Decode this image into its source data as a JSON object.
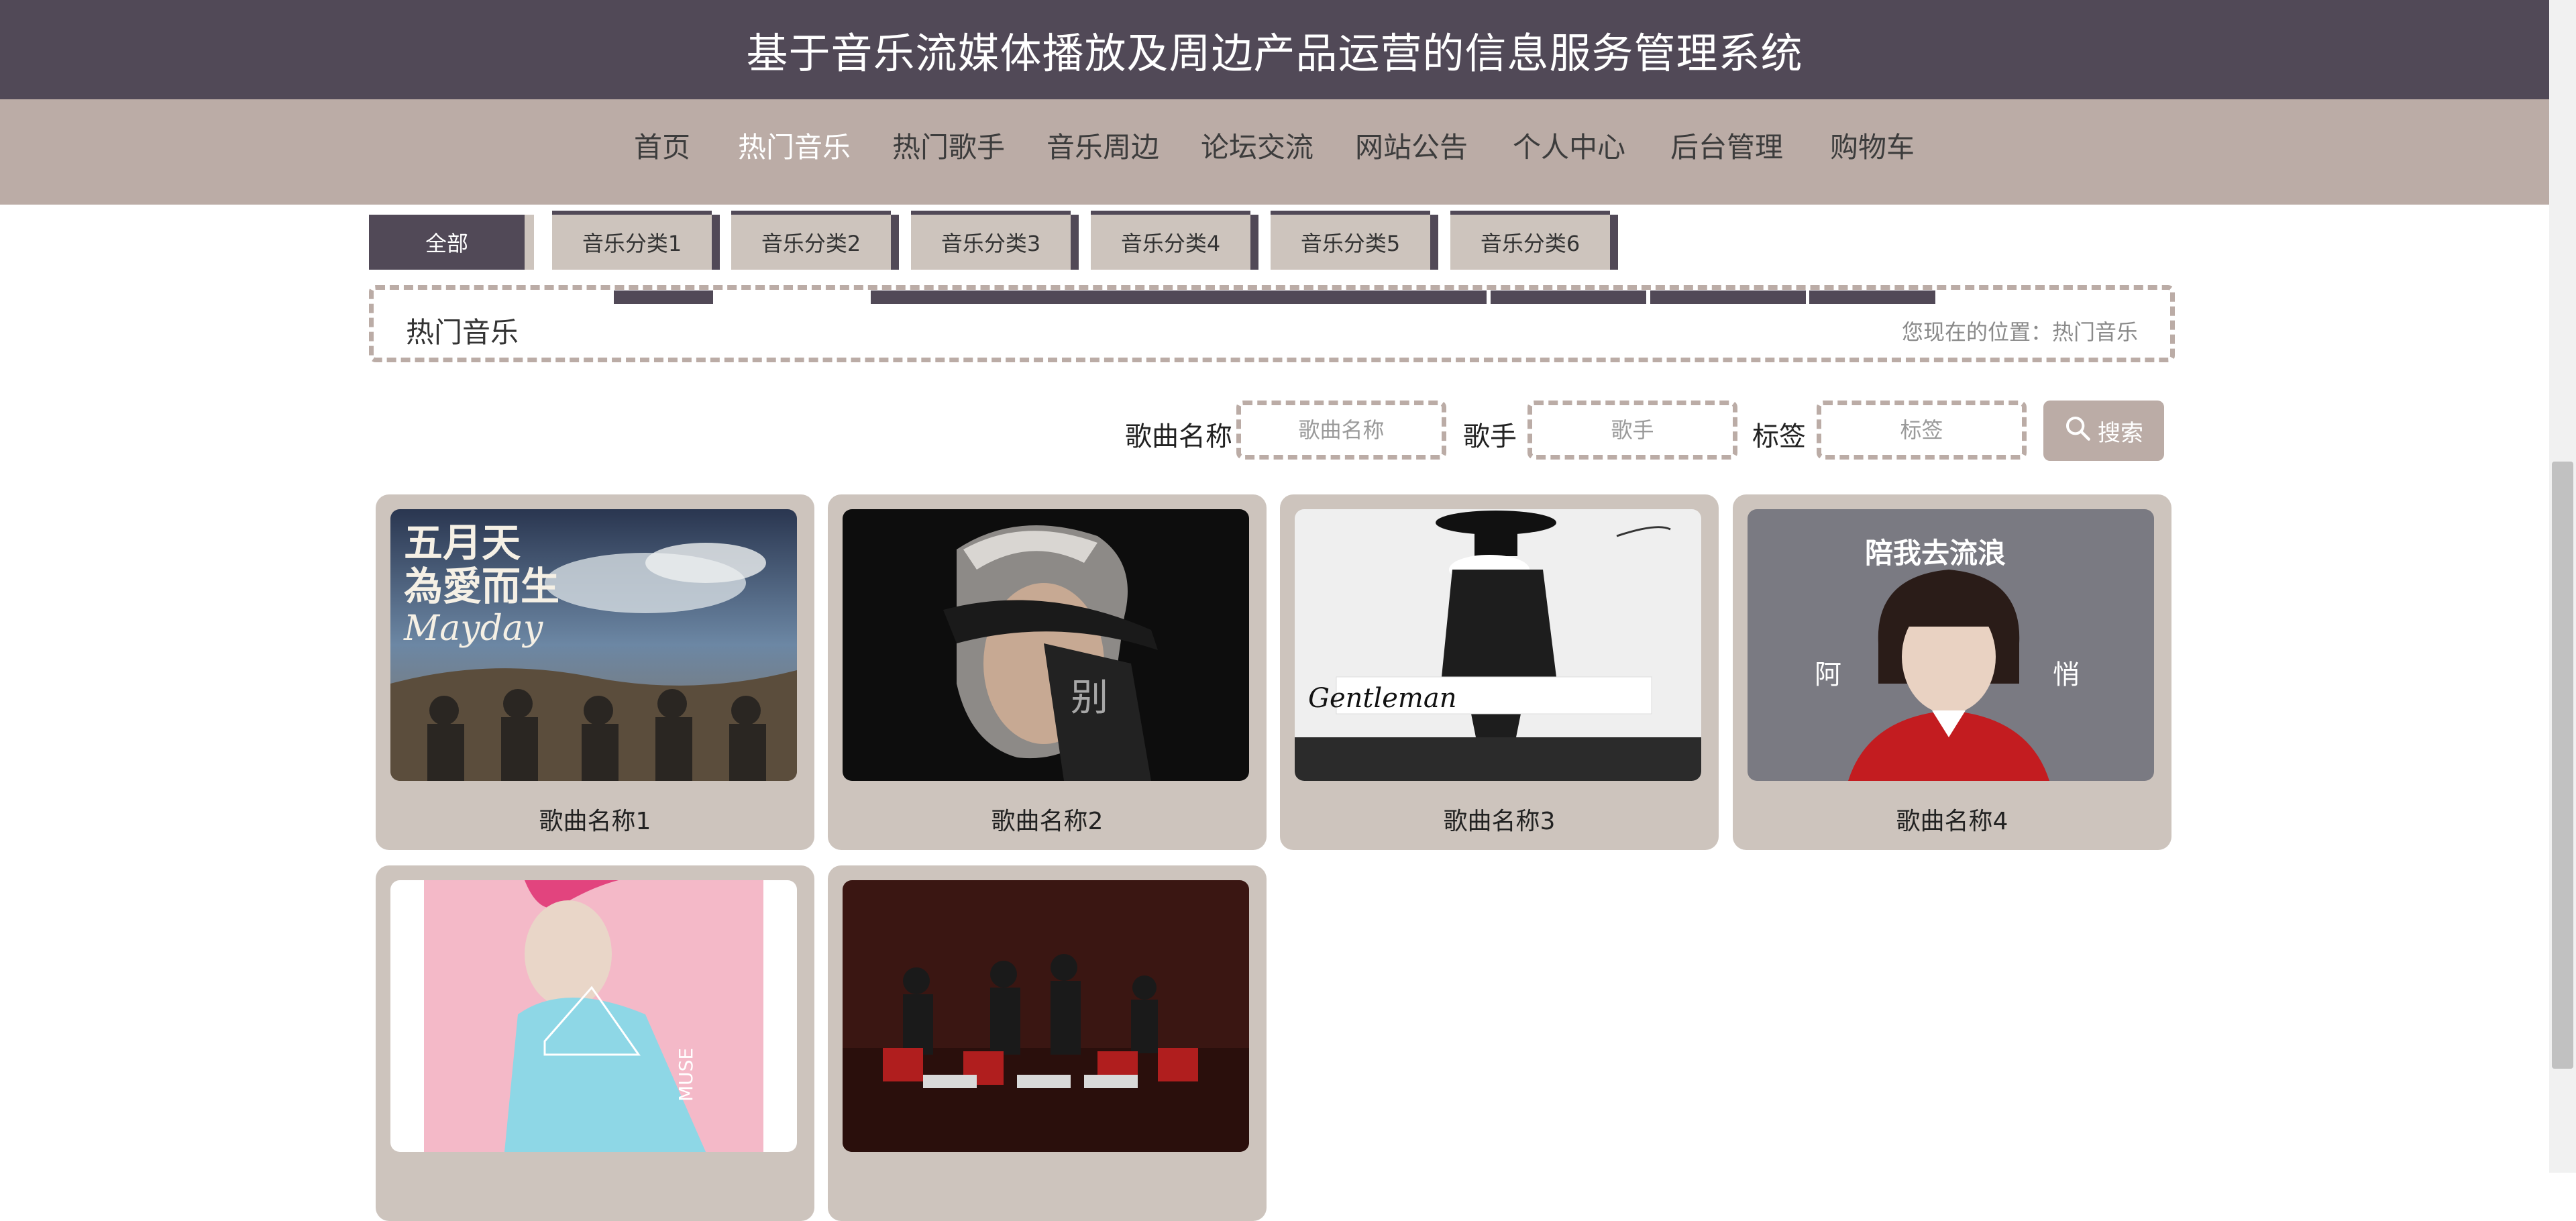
{
  "header": {
    "title": "基于音乐流媒体播放及周边产品运营的信息服务管理系统"
  },
  "nav": {
    "items": [
      {
        "label": "首页"
      },
      {
        "label": "热门音乐",
        "active": true
      },
      {
        "label": "热门歌手"
      },
      {
        "label": "音乐周边"
      },
      {
        "label": "论坛交流"
      },
      {
        "label": "网站公告"
      },
      {
        "label": "个人中心"
      },
      {
        "label": "后台管理"
      },
      {
        "label": "购物车"
      }
    ]
  },
  "categories": [
    {
      "label": "全部",
      "active": true
    },
    {
      "label": "音乐分类1"
    },
    {
      "label": "音乐分类2"
    },
    {
      "label": "音乐分类3"
    },
    {
      "label": "音乐分类4"
    },
    {
      "label": "音乐分类5"
    },
    {
      "label": "音乐分类6"
    }
  ],
  "breadcrumb": {
    "title": "热门音乐",
    "prefix": "您现在的位置：",
    "current": "热门音乐"
  },
  "search": {
    "song_label": "歌曲名称",
    "song_placeholder": "歌曲名称",
    "singer_label": "歌手",
    "singer_placeholder": "歌手",
    "tag_label": "标签",
    "tag_placeholder": "标签",
    "button_label": "搜索",
    "button_icon": "search-icon"
  },
  "songs": [
    {
      "name": "歌曲名称1",
      "cover_text": [
        "五月天",
        "為愛而生",
        "Mayday"
      ]
    },
    {
      "name": "歌曲名称2",
      "cover_text": [
        "别"
      ]
    },
    {
      "name": "歌曲名称3",
      "cover_text": [
        "Gentleman"
      ]
    },
    {
      "name": "歌曲名称4",
      "cover_text": [
        "陪我去流浪",
        "阿",
        "悄"
      ]
    },
    {
      "name": "",
      "cover_text": [
        "MUSE"
      ]
    },
    {
      "name": "",
      "cover_text": []
    }
  ],
  "colors": {
    "header_bg": "#514957",
    "nav_bg": "#bbaca6",
    "card_bg": "#cdc4bd"
  }
}
